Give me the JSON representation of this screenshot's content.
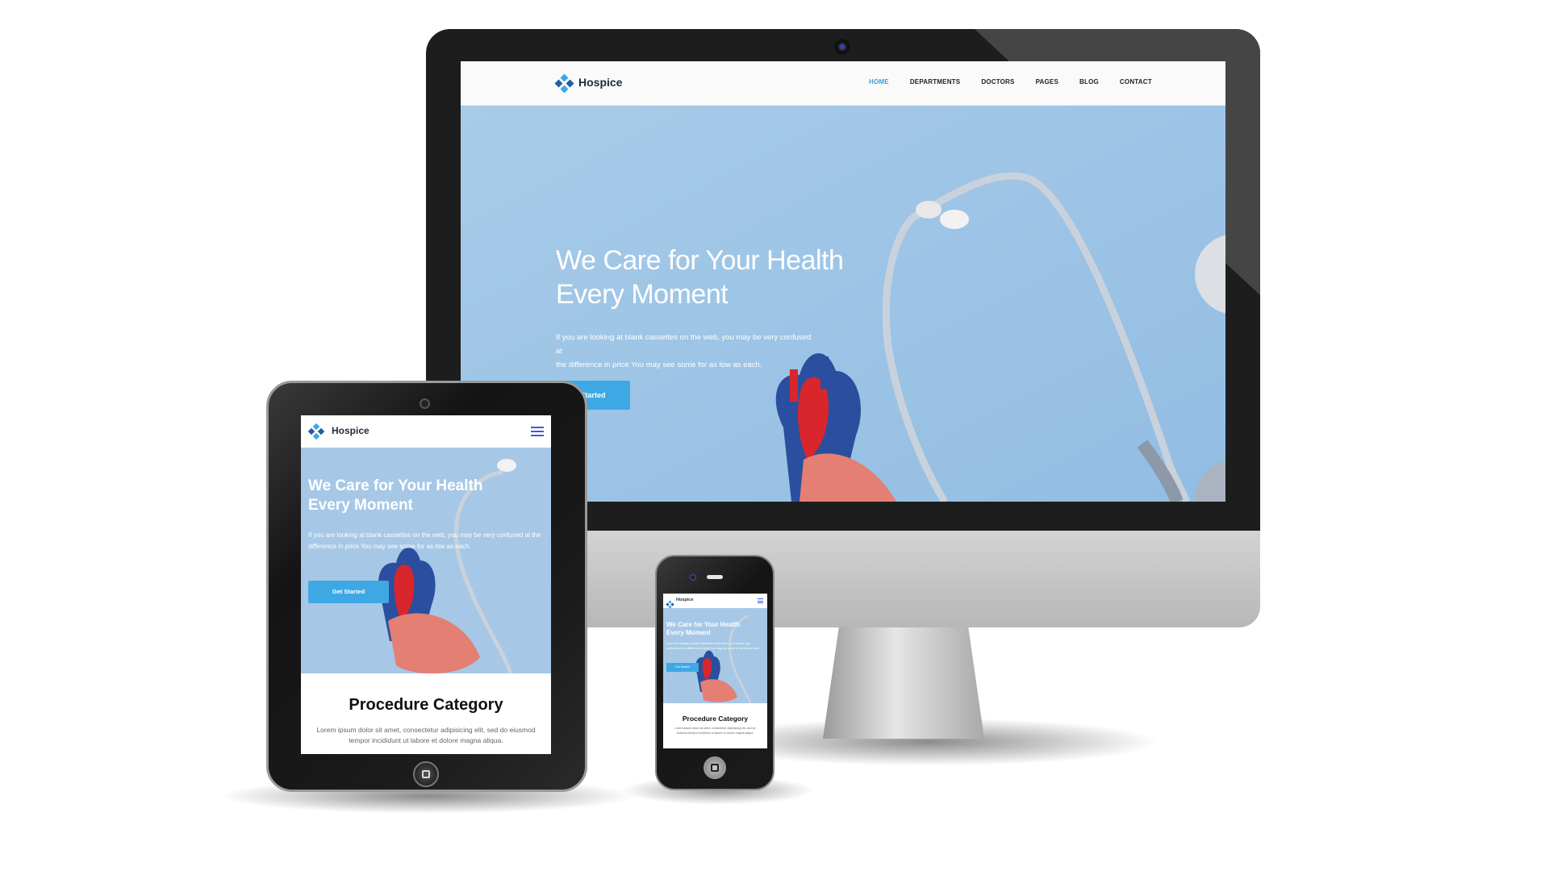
{
  "brand": {
    "name": "Hospice",
    "logo_icon": "diamond-cluster-logo",
    "accent": "#3ea8e4",
    "logo_dark": "#1f5fa8"
  },
  "desktop": {
    "nav": [
      "HOME",
      "DEPARTMENTS",
      "DOCTORS",
      "PAGES",
      "BLOG",
      "CONTACT"
    ],
    "active_nav": "HOME",
    "hero": {
      "title_line1": "We Care for Your Health",
      "title_line2": "Every Moment",
      "text_line1": "If you are looking at blank cassettes on the web, you may be very confused at",
      "text_line2": "the difference in price You may see some for as low as each.",
      "button": "Started"
    }
  },
  "tablet": {
    "hero": {
      "title_line1": "We Care for Your Health",
      "title_line2": "Every Moment",
      "text": "If you are looking at blank cassettes on the web, you may be very confused at the difference in price You may see some for as low as each.",
      "button": "Get Started"
    },
    "section": {
      "title": "Procedure Category",
      "text": "Lorem ipsum dolor sit amet, consectetur adipisicing elit, sed do eiusmod tempor incididunt ut labore et dolore magna aliqua."
    }
  },
  "phone": {
    "hero": {
      "title_line1": "We Care for Your Health",
      "title_line2": "Every Moment",
      "text": "If you are looking at blank cassettes on the web, you may be very confused at the difference in price You may see some for as low as each.",
      "button": "Get Started"
    },
    "section": {
      "title": "Procedure Category",
      "text": "Lorem ipsum dolor sit amet, consectetur adipisicing elit, sed do eiusmod tempor incididunt ut labore et dolore magna aliqua."
    }
  }
}
